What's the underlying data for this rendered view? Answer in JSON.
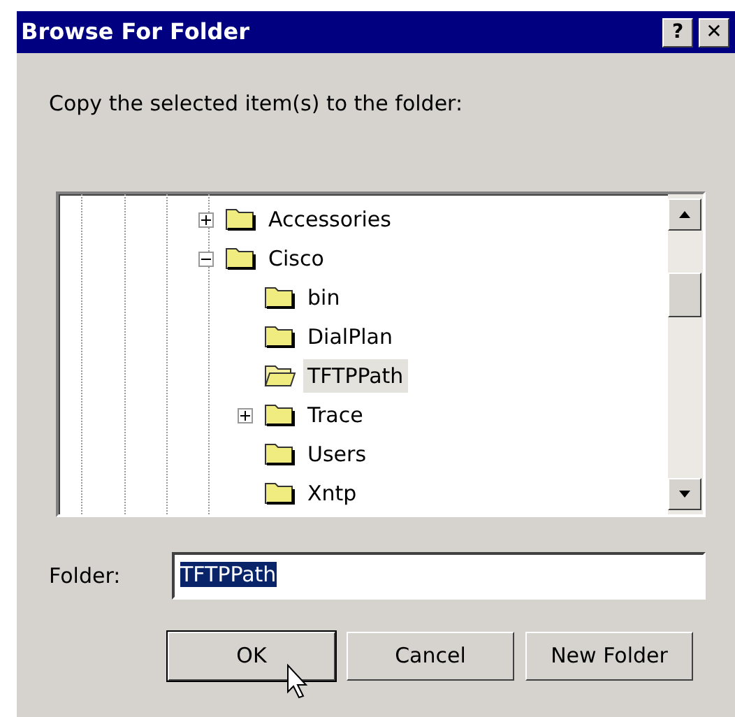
{
  "window": {
    "title": "Browse For Folder",
    "buttons": [
      "?",
      "✕"
    ]
  },
  "prompt": "Copy the selected item(s) to the folder:",
  "tree": [
    {
      "label": "Accessories",
      "expanded": false,
      "selected": false
    },
    {
      "label": "Cisco",
      "expanded": true,
      "selected": false,
      "children": [
        {
          "label": "bin",
          "selected": false
        },
        {
          "label": "DialPlan",
          "selected": false
        },
        {
          "label": "TFTPPath",
          "selected": true
        },
        {
          "label": "Trace",
          "expanded": false,
          "selected": false
        },
        {
          "label": "Users",
          "selected": false
        },
        {
          "label": "Xntp",
          "selected": false
        }
      ]
    }
  ],
  "folder_field": {
    "label": "Folder:",
    "value": "TFTPPath"
  },
  "buttons": [
    {
      "label": "OK",
      "focused": true
    },
    {
      "label": "Cancel",
      "focused": false
    },
    {
      "label": "New Folder",
      "focused": false
    }
  ]
}
